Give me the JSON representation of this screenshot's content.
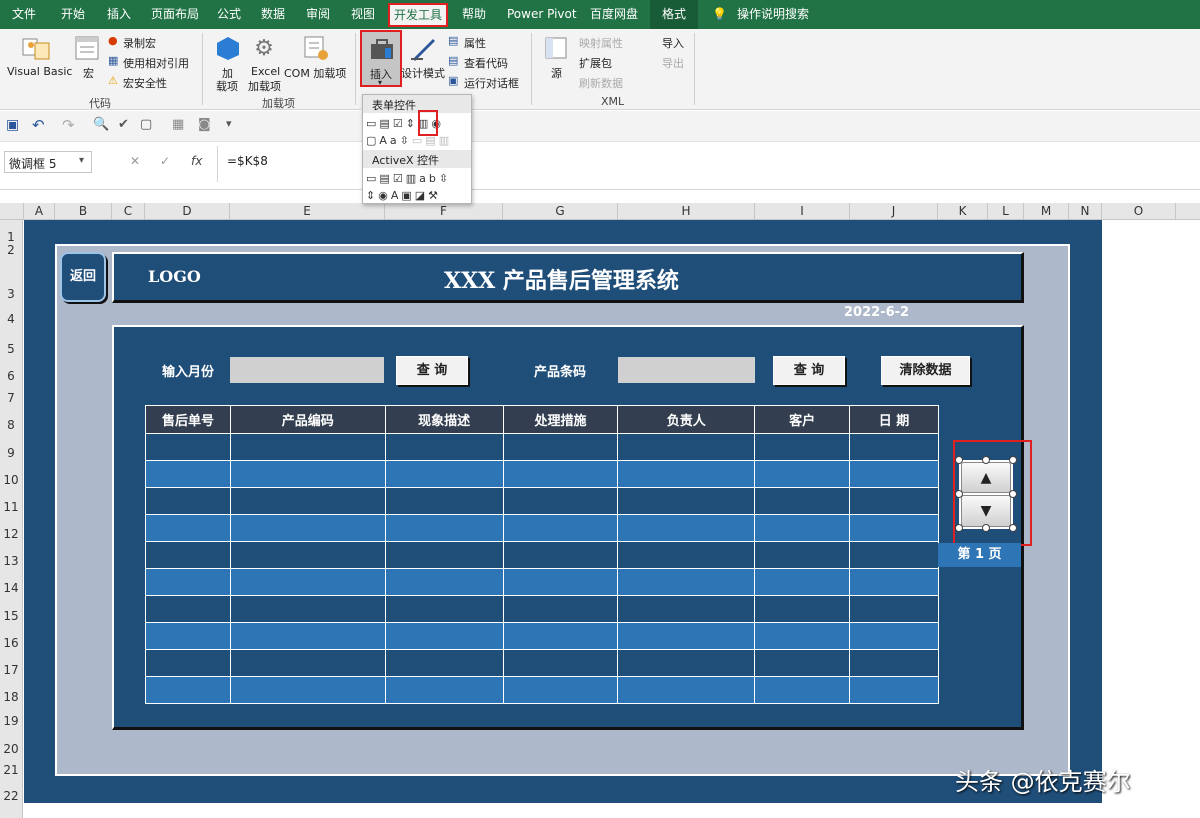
{
  "tabs": [
    {
      "label": "文件"
    },
    {
      "label": "开始"
    },
    {
      "label": "插入"
    },
    {
      "label": "页面布局"
    },
    {
      "label": "公式"
    },
    {
      "label": "数据"
    },
    {
      "label": "审阅"
    },
    {
      "label": "视图"
    },
    {
      "label": "开发工具"
    },
    {
      "label": "帮助"
    },
    {
      "label": "Power Pivot"
    },
    {
      "label": "百度网盘"
    },
    {
      "label": "格式"
    }
  ],
  "tell_me": "操作说明搜索",
  "ribbon": {
    "code": {
      "visual_basic": "Visual Basic",
      "macro": "宏",
      "record": "录制宏",
      "relative": "使用相对引用",
      "security": "宏安全性",
      "group": "代码"
    },
    "addins": {
      "addin_top": "加",
      "addin_bottom": "载项",
      "excel_top": "Excel",
      "excel_bottom": "加载项",
      "com": "COM 加载项",
      "group": "加载项"
    },
    "controls": {
      "insert": "插入",
      "design": "设计模式",
      "properties": "属性",
      "view_code": "查看代码",
      "run_dialog": "运行对话框"
    },
    "xml": {
      "source": "源",
      "map_props": "映射属性",
      "expansion": "扩展包",
      "refresh": "刷新数据",
      "import": "导入",
      "export": "导出",
      "group": "XML"
    }
  },
  "dropdown": {
    "form_controls": "表单控件",
    "activex": "ActiveX 控件"
  },
  "formula": {
    "name_box": "微调框 5",
    "fx": "fx",
    "value": "=$K$8"
  },
  "columns": [
    "A",
    "B",
    "C",
    "D",
    "E",
    "F",
    "G",
    "H",
    "I",
    "J",
    "K",
    "L",
    "M",
    "N",
    "O"
  ],
  "rows": [
    "1",
    "2",
    "3",
    "4",
    "5",
    "6",
    "7",
    "8",
    "9",
    "10",
    "11",
    "12",
    "13",
    "14",
    "15",
    "16",
    "17",
    "18",
    "19",
    "20",
    "21",
    "22"
  ],
  "dashboard": {
    "back": "返回",
    "logo": "LOGO",
    "title": "XXX 产品售后管理系统",
    "date": "2022-6-2",
    "month_label": "输入月份",
    "query1": "查 询",
    "barcode_label": "产品条码",
    "query2": "查 询",
    "clear": "清除数据",
    "headers": [
      "售后单号",
      "产品编码",
      "现象描述",
      "处理措施",
      "负责人",
      "客户",
      "日 期"
    ],
    "page_label": "第 1 页"
  },
  "watermark": "头条 @依克赛尔"
}
